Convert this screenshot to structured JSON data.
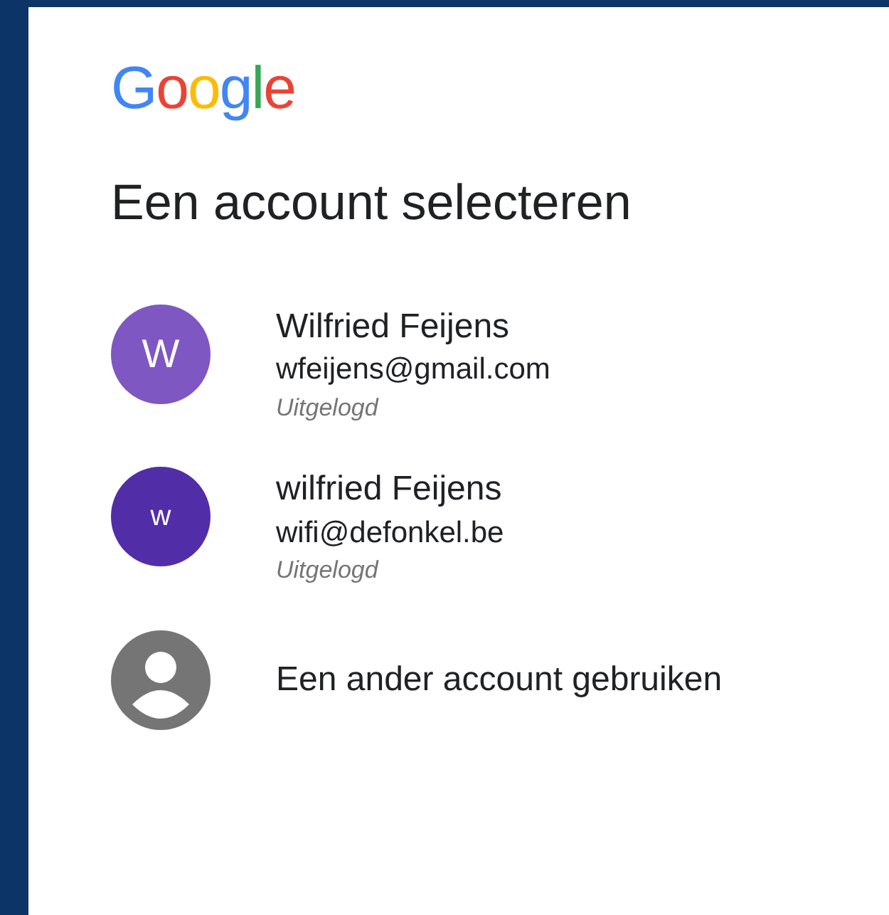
{
  "logo": "Google",
  "title": "Een account selecteren",
  "accounts": [
    {
      "kind": "account",
      "initial": "W",
      "color": "#7e57c2",
      "name": "Wilfried Feijens",
      "email": "wfeijens@gmail.com",
      "status": "Uitgelogd"
    },
    {
      "kind": "account",
      "initial": "w",
      "color": "#512da8",
      "name": "wilfried Feijens",
      "email": "wifi@defonkel.be",
      "status": "Uitgelogd"
    },
    {
      "kind": "other",
      "name": "Een ander account gebruiken"
    }
  ]
}
